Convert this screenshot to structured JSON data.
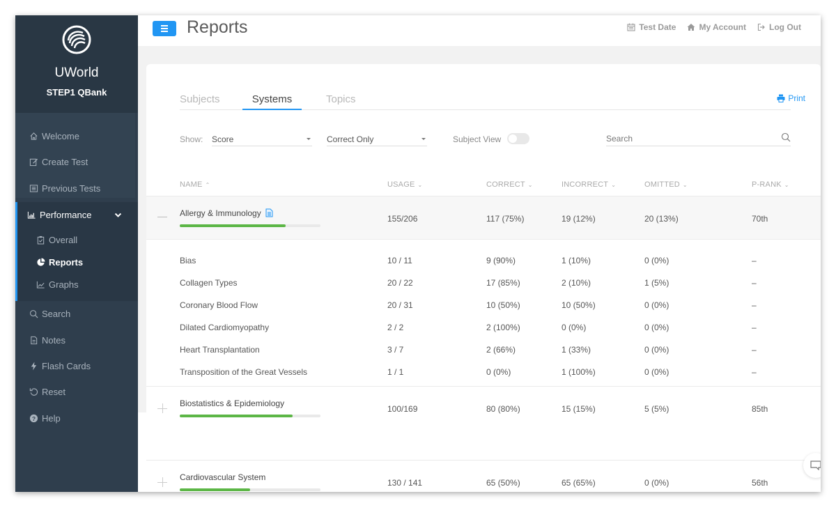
{
  "brand": {
    "name": "UWorld",
    "product": "STEP1 QBank"
  },
  "sidebar": {
    "items": [
      {
        "label": "Welcome",
        "icon": "home-icon"
      },
      {
        "label": "Create Test",
        "icon": "edit-icon"
      },
      {
        "label": "Previous Tests",
        "icon": "list-icon"
      },
      {
        "label": "Performance",
        "icon": "bar-chart-icon"
      },
      {
        "label": "Overall",
        "icon": "clipboard-check-icon"
      },
      {
        "label": "Reports",
        "icon": "pie-chart-icon"
      },
      {
        "label": "Graphs",
        "icon": "line-chart-icon"
      },
      {
        "label": "Search",
        "icon": "search-icon"
      },
      {
        "label": "Notes",
        "icon": "note-icon"
      },
      {
        "label": "Flash Cards",
        "icon": "bolt-icon"
      },
      {
        "label": "Reset",
        "icon": "reset-icon"
      },
      {
        "label": "Help",
        "icon": "help-icon"
      }
    ]
  },
  "header": {
    "title": "Reports",
    "links": [
      {
        "label": "Test Date",
        "icon": "calendar-icon"
      },
      {
        "label": "My Account",
        "icon": "home-icon"
      },
      {
        "label": "Log Out",
        "icon": "logout-icon"
      }
    ]
  },
  "tabs": [
    {
      "label": "Subjects",
      "active": false
    },
    {
      "label": "Systems",
      "active": true
    },
    {
      "label": "Topics",
      "active": false
    }
  ],
  "print_label": "Print",
  "filters": {
    "show_label": "Show:",
    "show_value": "Score",
    "filter_value": "Correct Only",
    "subject_view_label": "Subject View",
    "subject_view_on": false,
    "search_placeholder": "Search"
  },
  "columns": [
    {
      "label": "NAME",
      "sort": "asc"
    },
    {
      "label": "USAGE",
      "sort": "desc"
    },
    {
      "label": "CORRECT",
      "sort": "desc"
    },
    {
      "label": "INCORRECT",
      "sort": "desc"
    },
    {
      "label": "OMITTED",
      "sort": "desc"
    },
    {
      "label": "P-RANK",
      "sort": "desc"
    }
  ],
  "groups": [
    {
      "name": "Allergy & Immunology",
      "has_notes": true,
      "expanded": true,
      "progress": 0.75,
      "usage": "155/206",
      "correct": "117 (75%)",
      "incorrect": "19 (12%)",
      "omitted": "20 (13%)",
      "prank": "70th",
      "children": [
        {
          "name": "Bias",
          "usage": "10 / 11",
          "correct": "9 (90%)",
          "incorrect": "1 (10%)",
          "omitted": "0 (0%)",
          "prank": "–"
        },
        {
          "name": "Collagen Types",
          "usage": "20 / 22",
          "correct": "17 (85%)",
          "incorrect": "2 (10%)",
          "omitted": "1 (5%)",
          "prank": "–"
        },
        {
          "name": "Coronary Blood Flow",
          "usage": "20 / 31",
          "correct": "10 (50%)",
          "incorrect": "10 (50%)",
          "omitted": "0 (0%)",
          "prank": "–"
        },
        {
          "name": "Dilated Cardiomyopathy",
          "usage": "2 / 2",
          "correct": "2 (100%)",
          "incorrect": "0 (0%)",
          "omitted": "0 (0%)",
          "prank": "–"
        },
        {
          "name": "Heart Transplantation",
          "usage": "3 / 7",
          "correct": "2 (66%)",
          "incorrect": "1 (33%)",
          "omitted": "0 (0%)",
          "prank": "–"
        },
        {
          "name": "Transposition of the Great Vessels",
          "usage": "1 / 1",
          "correct": "0 (0%)",
          "incorrect": "1 (100%)",
          "omitted": "0 (0%)",
          "prank": "–"
        }
      ]
    },
    {
      "name": "Biostatistics & Epidemiology",
      "has_notes": false,
      "expanded": false,
      "progress": 0.8,
      "usage": "100/169",
      "correct": "80 (80%)",
      "incorrect": "15 (15%)",
      "omitted": "5 (5%)",
      "prank": "85th"
    },
    {
      "name": "Cardiovascular System",
      "has_notes": false,
      "expanded": false,
      "progress": 0.5,
      "usage": "130 / 141",
      "correct": "65 (50%)",
      "incorrect": "65 (65%)",
      "omitted": "0 (0%)",
      "prank": "56th"
    }
  ],
  "colors": {
    "accent": "#2196f3",
    "sidebar_bg": "#2f3e4d",
    "progress_fill": "#5cb646"
  }
}
